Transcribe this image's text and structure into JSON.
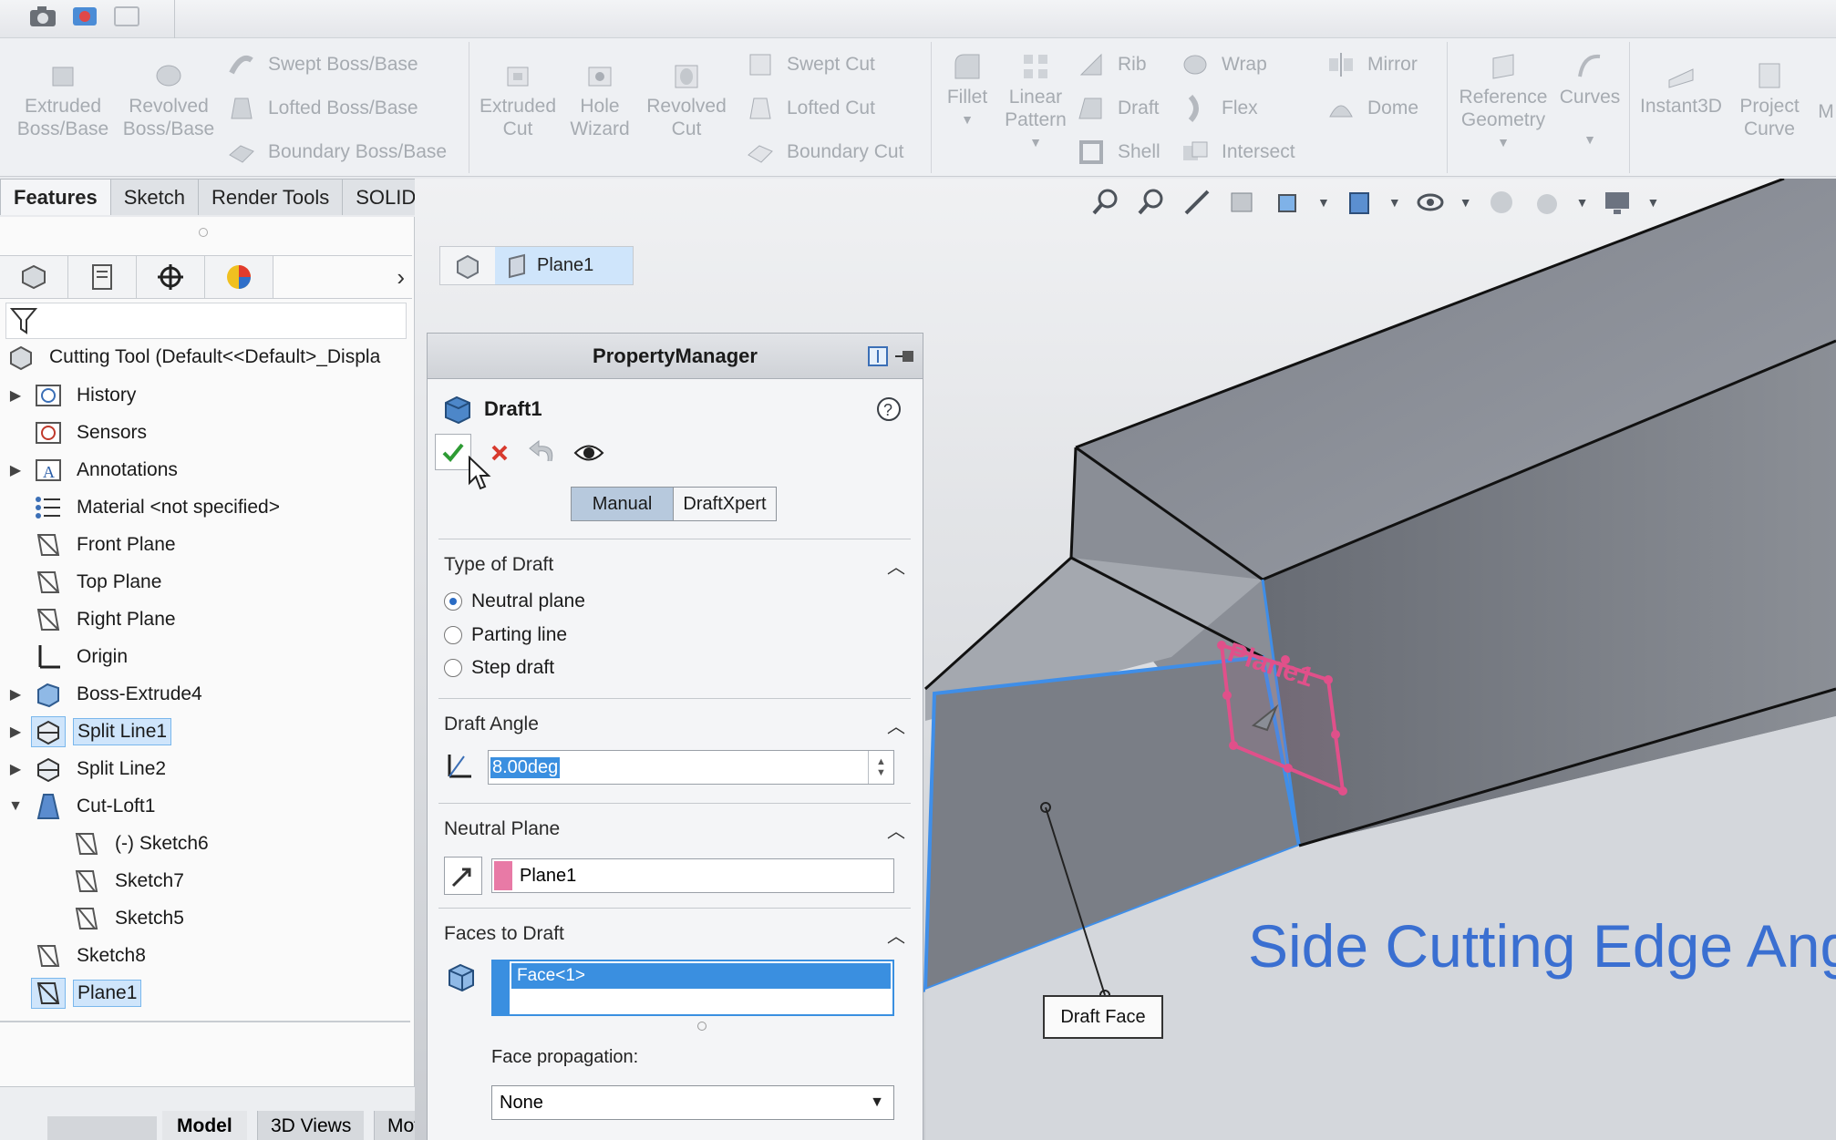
{
  "ribbon": {
    "features": {
      "extruded_boss": "Extruded\nBoss/Base",
      "revolved_boss": "Revolved\nBoss/Base",
      "swept_boss": "Swept Boss/Base",
      "lofted_boss": "Lofted Boss/Base",
      "boundary_boss": "Boundary Boss/Base",
      "extruded_cut": "Extruded\nCut",
      "hole_wizard": "Hole\nWizard",
      "revolved_cut": "Revolved\nCut",
      "swept_cut": "Swept Cut",
      "lofted_cut": "Lofted Cut",
      "boundary_cut": "Boundary Cut",
      "fillet": "Fillet",
      "linear_pattern": "Linear\nPattern",
      "rib": "Rib",
      "draft": "Draft",
      "shell": "Shell",
      "wrap": "Wrap",
      "flex": "Flex",
      "intersect": "Intersect",
      "mirror": "Mirror",
      "dome": "Dome",
      "reference_geometry": "Reference\nGeometry",
      "curves": "Curves",
      "instant3d": "Instant3D",
      "project_curve": "Project\nCurve",
      "more": "M"
    }
  },
  "tabs": [
    "Features",
    "Sketch",
    "Render Tools",
    "SOLIDWORKS Add-Ins"
  ],
  "tree": {
    "root": "Cutting Tool  (Default<<Default>_Displa",
    "items": [
      {
        "label": "History"
      },
      {
        "label": "Sensors"
      },
      {
        "label": "Annotations"
      },
      {
        "label": "Material <not specified>"
      },
      {
        "label": "Front Plane"
      },
      {
        "label": "Top Plane"
      },
      {
        "label": "Right Plane"
      },
      {
        "label": "Origin"
      },
      {
        "label": "Boss-Extrude4"
      },
      {
        "label": "Split Line1"
      },
      {
        "label": "Split Line2"
      },
      {
        "label": "Cut-Loft1"
      },
      {
        "label": "(-) Sketch6"
      },
      {
        "label": "Sketch7"
      },
      {
        "label": "Sketch5"
      },
      {
        "label": "Sketch8"
      },
      {
        "label": "Plane1"
      }
    ]
  },
  "bottom_tabs": [
    "Model",
    "3D Views",
    "Mot"
  ],
  "breadcrumb": {
    "item": "Plane1"
  },
  "property_manager": {
    "header": "PropertyManager",
    "feature_name": "Draft1",
    "mode_tabs": [
      "Manual",
      "DraftXpert"
    ],
    "type_of_draft": {
      "title": "Type of Draft",
      "options": [
        "Neutral plane",
        "Parting line",
        "Step draft"
      ],
      "selected": "Neutral plane"
    },
    "draft_angle": {
      "title": "Draft Angle",
      "value": "8.00deg"
    },
    "neutral_plane": {
      "title": "Neutral Plane",
      "value": "Plane1",
      "color": "#e87aa6"
    },
    "faces_to_draft": {
      "title": "Faces to Draft",
      "items": [
        "Face<1>"
      ]
    },
    "face_propagation": {
      "label": "Face propagation:",
      "value": "None"
    }
  },
  "viewport": {
    "overlay_caption": "Side Cutting Edge Angle",
    "callout": "Draft Face",
    "plane_label": "Plane1"
  },
  "colors": {
    "accent_blue": "#3a8fe0",
    "selection_bg": "#cfe5fb",
    "plane_pink": "#e0508a"
  }
}
